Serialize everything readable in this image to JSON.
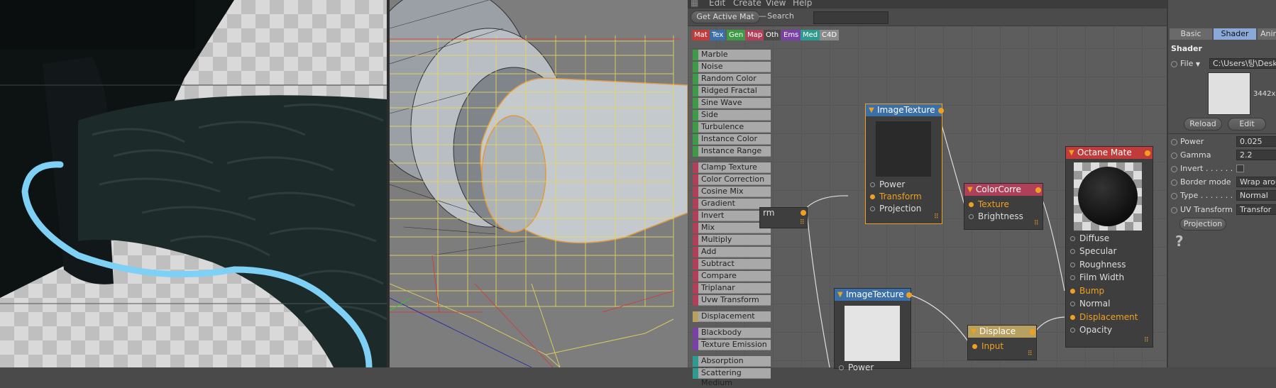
{
  "menu": {
    "items": [
      "Edit",
      "Create",
      "View",
      "Help"
    ]
  },
  "toolbar": {
    "get_active_mat": "Get Active Mat",
    "search_label": "Search",
    "search_value": ""
  },
  "category_tabs": [
    {
      "label": "Mat",
      "color": "#c23b3b"
    },
    {
      "label": "Tex",
      "color": "#3b6fa8"
    },
    {
      "label": "Gen",
      "color": "#3e9a46"
    },
    {
      "label": "Map",
      "color": "#b0405a"
    },
    {
      "label": "Oth",
      "color": "#4a4a4a"
    },
    {
      "label": "Ems",
      "color": "#7b3fa8"
    },
    {
      "label": "Med",
      "color": "#2f9a8f"
    },
    {
      "label": "C4D",
      "color": "#8c8c8c"
    }
  ],
  "node_list": [
    {
      "label": "Marble",
      "color": "#3e9a46"
    },
    {
      "label": "Noise",
      "color": "#3e9a46"
    },
    {
      "label": "Random Color",
      "color": "#3e9a46"
    },
    {
      "label": "Ridged Fractal",
      "color": "#3e9a46"
    },
    {
      "label": "Sine Wave",
      "color": "#3e9a46"
    },
    {
      "label": "Side",
      "color": "#3e9a46"
    },
    {
      "label": "Turbulence",
      "color": "#3e9a46"
    },
    {
      "label": "Instance Color",
      "color": "#3e9a46"
    },
    {
      "label": "Instance Range",
      "color": "#3e9a46"
    },
    {
      "label": "Clamp Texture",
      "color": "#b0405a"
    },
    {
      "label": "Color Correction",
      "color": "#b0405a"
    },
    {
      "label": "Cosine Mix",
      "color": "#b0405a"
    },
    {
      "label": "Gradient",
      "color": "#b0405a"
    },
    {
      "label": "Invert",
      "color": "#b0405a"
    },
    {
      "label": "Mix",
      "color": "#b0405a"
    },
    {
      "label": "Multiply",
      "color": "#b0405a"
    },
    {
      "label": "Add",
      "color": "#b0405a"
    },
    {
      "label": "Subtract",
      "color": "#b0405a"
    },
    {
      "label": "Compare",
      "color": "#b0405a"
    },
    {
      "label": "Triplanar",
      "color": "#b0405a"
    },
    {
      "label": "Uvw Transform",
      "color": "#b0405a"
    },
    {
      "label": "Displacement",
      "color": "#b8a060"
    },
    {
      "label": "Blackbody Emission",
      "color": "#7b3fa8"
    },
    {
      "label": "Texture Emission",
      "color": "#7b3fa8"
    },
    {
      "label": "Absorption Medium",
      "color": "#2f9a8f"
    },
    {
      "label": "Scattering Medium",
      "color": "#2f9a8f"
    }
  ],
  "nodes": {
    "transform_partial": {
      "label": "rm"
    },
    "image_texture_1": {
      "title": "ImageTexture",
      "ports": [
        "Power",
        "Transform",
        "Projection"
      ]
    },
    "color_correction": {
      "title": "ColorCorre",
      "ports": [
        "Texture",
        "Brightness"
      ]
    },
    "octane_material": {
      "title": "Octane Mate",
      "ports": [
        "Diffuse",
        "Specular",
        "Roughness",
        "Film Width",
        "Bump",
        "Normal",
        "Displacement",
        "Opacity"
      ]
    },
    "image_texture_2": {
      "title": "ImageTexture",
      "ports": [
        "Power"
      ]
    },
    "displacement": {
      "title": "Displace",
      "ports": [
        "Input"
      ]
    }
  },
  "attributes": {
    "tabs": [
      "Basic",
      "Shader",
      "Anima"
    ],
    "section": "Shader",
    "file_label": "File",
    "file_path": "C:\\Users\\탕\\Desk",
    "image_size": "3442x",
    "reload": "Reload",
    "edit": "Edit",
    "power_label": "Power",
    "power_value": "0.025",
    "gamma_label": "Gamma",
    "gamma_value": "2.2",
    "invert_label": "Invert . . . . . .",
    "border_label": "Border mode",
    "border_value": "Wrap arou",
    "type_label": "Type . . . . . . .",
    "type_value": "Normal",
    "uv_label": "UV Transform",
    "uv_value": "Transfor",
    "projection": "Projection",
    "help": "?"
  },
  "colors": {
    "accent_orange": "#f0a020",
    "selection_cyan": "#7fd0f5",
    "shader_tab": "#8aa8d8"
  }
}
